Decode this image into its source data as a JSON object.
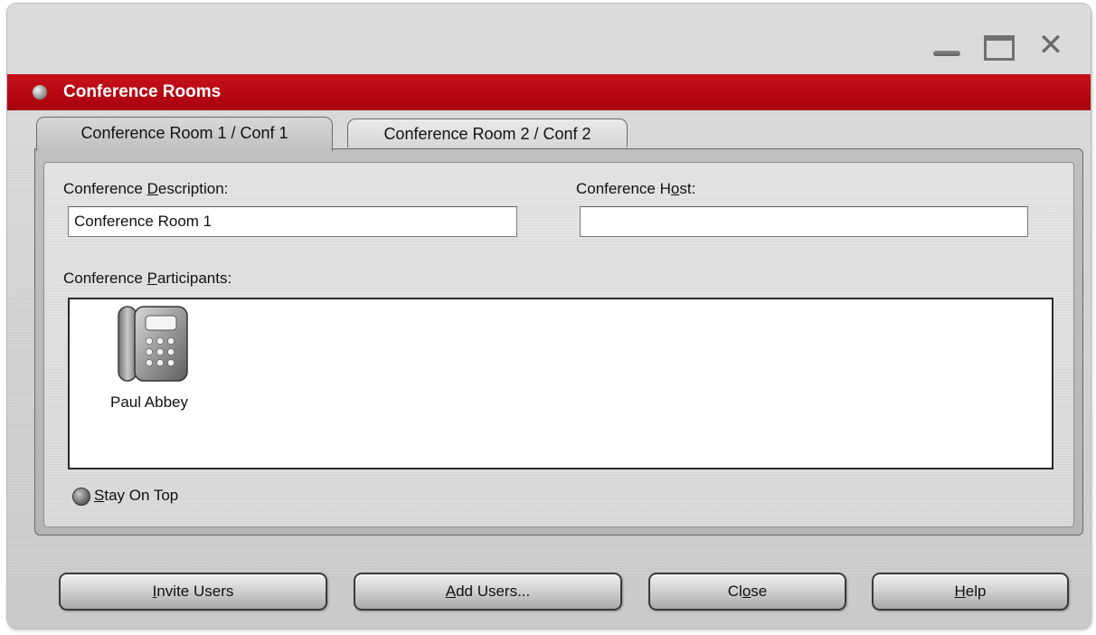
{
  "window": {
    "title": "Conference Rooms",
    "controls": {
      "minimize": "minimize",
      "maximize": "maximize",
      "close": "close"
    }
  },
  "tabs": [
    {
      "label": "Conference Room 1 / Conf 1",
      "active": true
    },
    {
      "label": "Conference Room 2 / Conf 2",
      "active": false
    }
  ],
  "form": {
    "description_label_pre": "Conference ",
    "description_label_key": "D",
    "description_label_post": "escription:",
    "description_value": "Conference Room 1",
    "host_label_pre": "Conference H",
    "host_label_key": "o",
    "host_label_post": "st:",
    "host_value": "",
    "participants_label_pre": "Conference ",
    "participants_label_key": "P",
    "participants_label_post": "articipants:"
  },
  "participants": [
    {
      "name": "Paul Abbey",
      "icon": "desk-phone-icon"
    }
  ],
  "stay_on_top": {
    "label_key": "S",
    "label_rest": "tay On Top",
    "checked": false
  },
  "buttons": {
    "invite": {
      "key": "I",
      "rest": "nvite Users"
    },
    "add": {
      "key": "A",
      "rest": "dd Users..."
    },
    "close": {
      "pre": "Cl",
      "key": "o",
      "post": "se"
    },
    "help": {
      "key": "H",
      "rest": "elp"
    }
  },
  "colors": {
    "title_bar": "#b80010",
    "window_bg": "#d4d4d4"
  }
}
